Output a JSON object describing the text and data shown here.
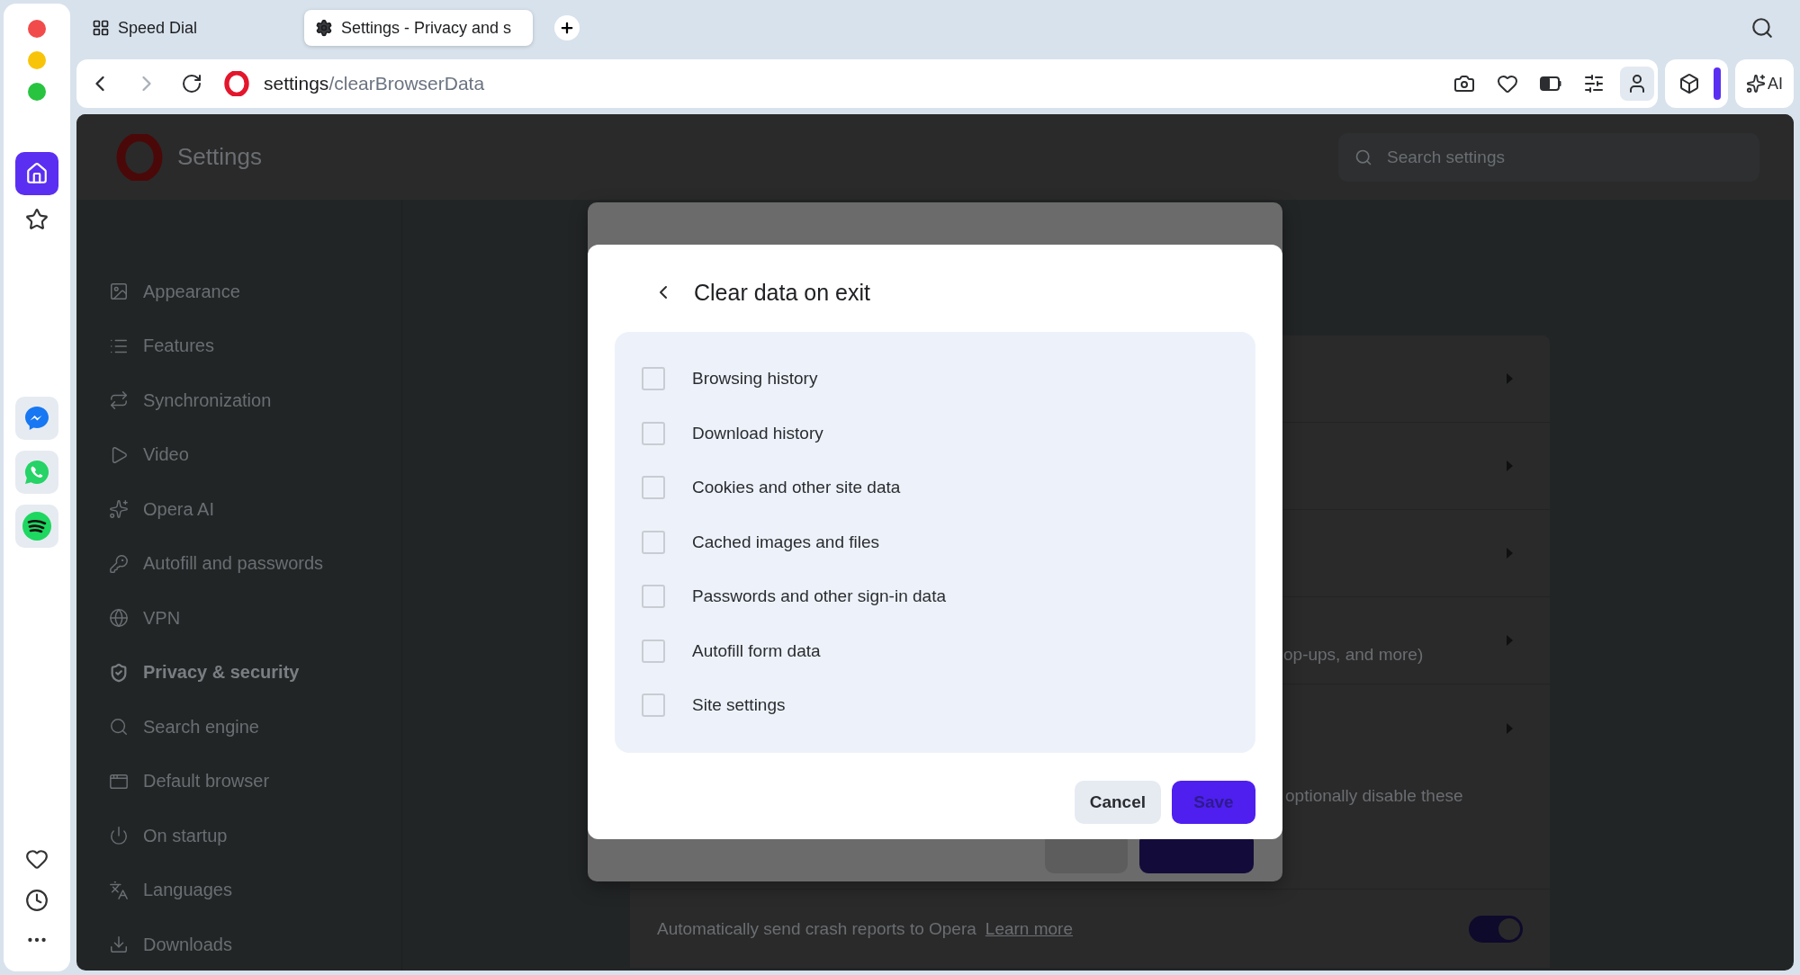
{
  "tabs": [
    {
      "label": "Speed Dial",
      "selected": false
    },
    {
      "label": "Settings - Privacy and s",
      "selected": true
    }
  ],
  "address": {
    "host": "settings",
    "path": "/clearBrowserData"
  },
  "ai_button": "AI",
  "settings": {
    "title": "Settings",
    "search_placeholder": "Search settings"
  },
  "nav": [
    {
      "label": "Appearance",
      "selected": false
    },
    {
      "label": "Features",
      "selected": false
    },
    {
      "label": "Synchronization",
      "selected": false
    },
    {
      "label": "Video",
      "selected": false
    },
    {
      "label": "Opera AI",
      "selected": false
    },
    {
      "label": "Autofill and passwords",
      "selected": false
    },
    {
      "label": "VPN",
      "selected": false
    },
    {
      "label": "Privacy & security",
      "selected": true
    },
    {
      "label": "Search engine",
      "selected": false
    },
    {
      "label": "Default browser",
      "selected": false
    },
    {
      "label": "On startup",
      "selected": false
    },
    {
      "label": "Languages",
      "selected": false
    },
    {
      "label": "Downloads",
      "selected": false
    }
  ],
  "card_rows": [
    {
      "text": ""
    },
    {
      "text": ""
    },
    {
      "text": ""
    },
    {
      "text": "op-ups, and more)"
    },
    {
      "text": ""
    }
  ],
  "card_note": "optionally disable these",
  "crash_row": {
    "text": "Automatically send crash reports to Opera",
    "link": "Learn more",
    "on": true
  },
  "dialog": {
    "title": "Clear data on exit",
    "options": [
      {
        "label": "Browsing history",
        "checked": false
      },
      {
        "label": "Download history",
        "checked": false
      },
      {
        "label": "Cookies and other site data",
        "checked": false
      },
      {
        "label": "Cached images and files",
        "checked": false
      },
      {
        "label": "Passwords and other sign-in data",
        "checked": false
      },
      {
        "label": "Autofill form data",
        "checked": false
      },
      {
        "label": "Site settings",
        "checked": false
      }
    ],
    "buttons": [
      {
        "label": "Cancel",
        "kind": "secondary",
        "disabled": false
      },
      {
        "label": "Save",
        "kind": "primary",
        "disabled": true
      }
    ]
  }
}
